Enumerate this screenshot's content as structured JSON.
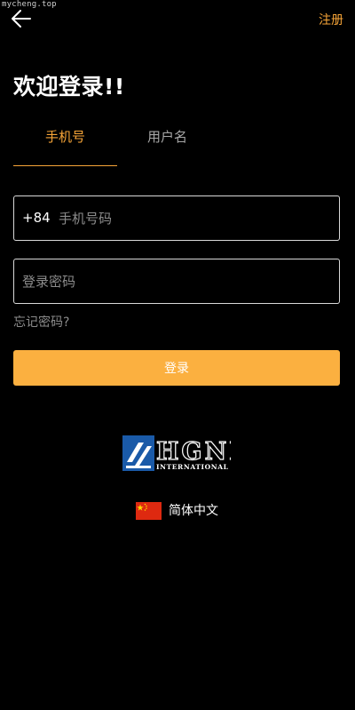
{
  "watermark": "mycheng.top",
  "header": {
    "back_icon": "arrow-left-icon",
    "register_label": "注册"
  },
  "title": "欢迎登录!!",
  "tabs": [
    {
      "label": "手机号",
      "active": true
    },
    {
      "label": "用户名",
      "active": false
    }
  ],
  "phone": {
    "country_code": "+84",
    "placeholder": "手机号码",
    "value": ""
  },
  "password": {
    "placeholder": "登录密码",
    "value": ""
  },
  "forgot_label": "忘记密码?",
  "login_label": "登录",
  "logo": {
    "text": "HGNH",
    "subtext": "INTERNATIONAL"
  },
  "language": {
    "flag_icon": "china-flag-icon",
    "label": "简体中文"
  },
  "colors": {
    "accent": "#f7a538",
    "button": "#fbb040",
    "background": "#000000",
    "muted": "#8c8c8c"
  }
}
